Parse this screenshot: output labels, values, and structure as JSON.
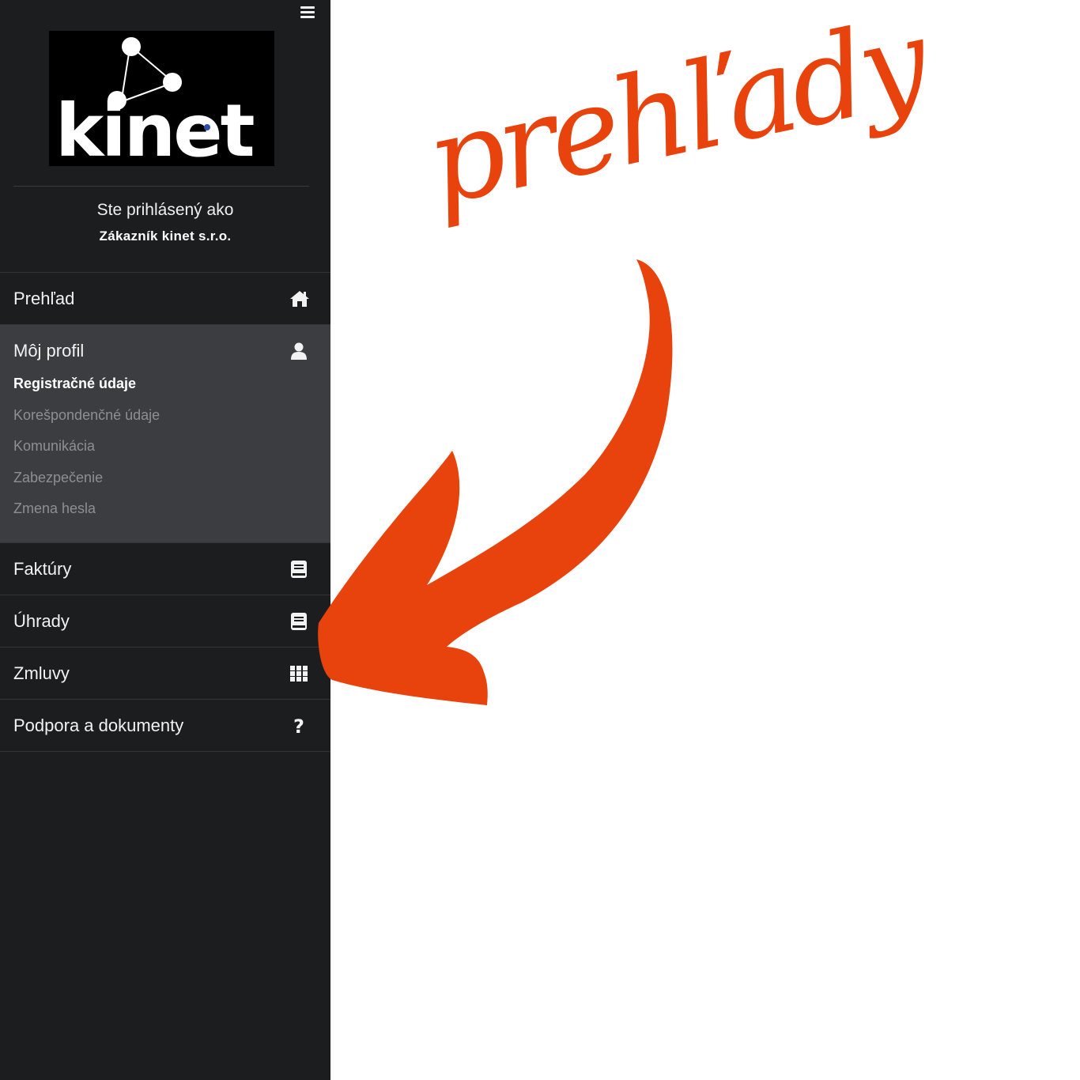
{
  "logo": {
    "text": "kinet"
  },
  "login": {
    "line1": "Ste prihlásený ako",
    "line2": "Zákazník kinet s.r.o."
  },
  "menu": {
    "items": [
      {
        "label": "Prehľad",
        "icon": "home-icon"
      },
      {
        "label": "Môj profil",
        "icon": "user-icon",
        "sub": [
          {
            "label": "Registračné údaje",
            "active": true
          },
          {
            "label": "Korešpondenčné údaje"
          },
          {
            "label": "Komunikácia"
          },
          {
            "label": "Zabezpečenie"
          },
          {
            "label": "Zmena hesla"
          }
        ]
      },
      {
        "label": "Faktúry",
        "icon": "book-icon"
      },
      {
        "label": "Úhrady",
        "icon": "book-icon"
      },
      {
        "label": "Zmluvy",
        "icon": "grid-icon"
      },
      {
        "label": "Podpora a dokumenty",
        "icon": "question-icon"
      }
    ]
  },
  "annotation": {
    "text": "prehľady",
    "color": "#e8420d"
  },
  "colors": {
    "sidebar_bg": "#1c1d1f",
    "expanded_bg": "#3c3d40",
    "accent": "#e8420d"
  }
}
